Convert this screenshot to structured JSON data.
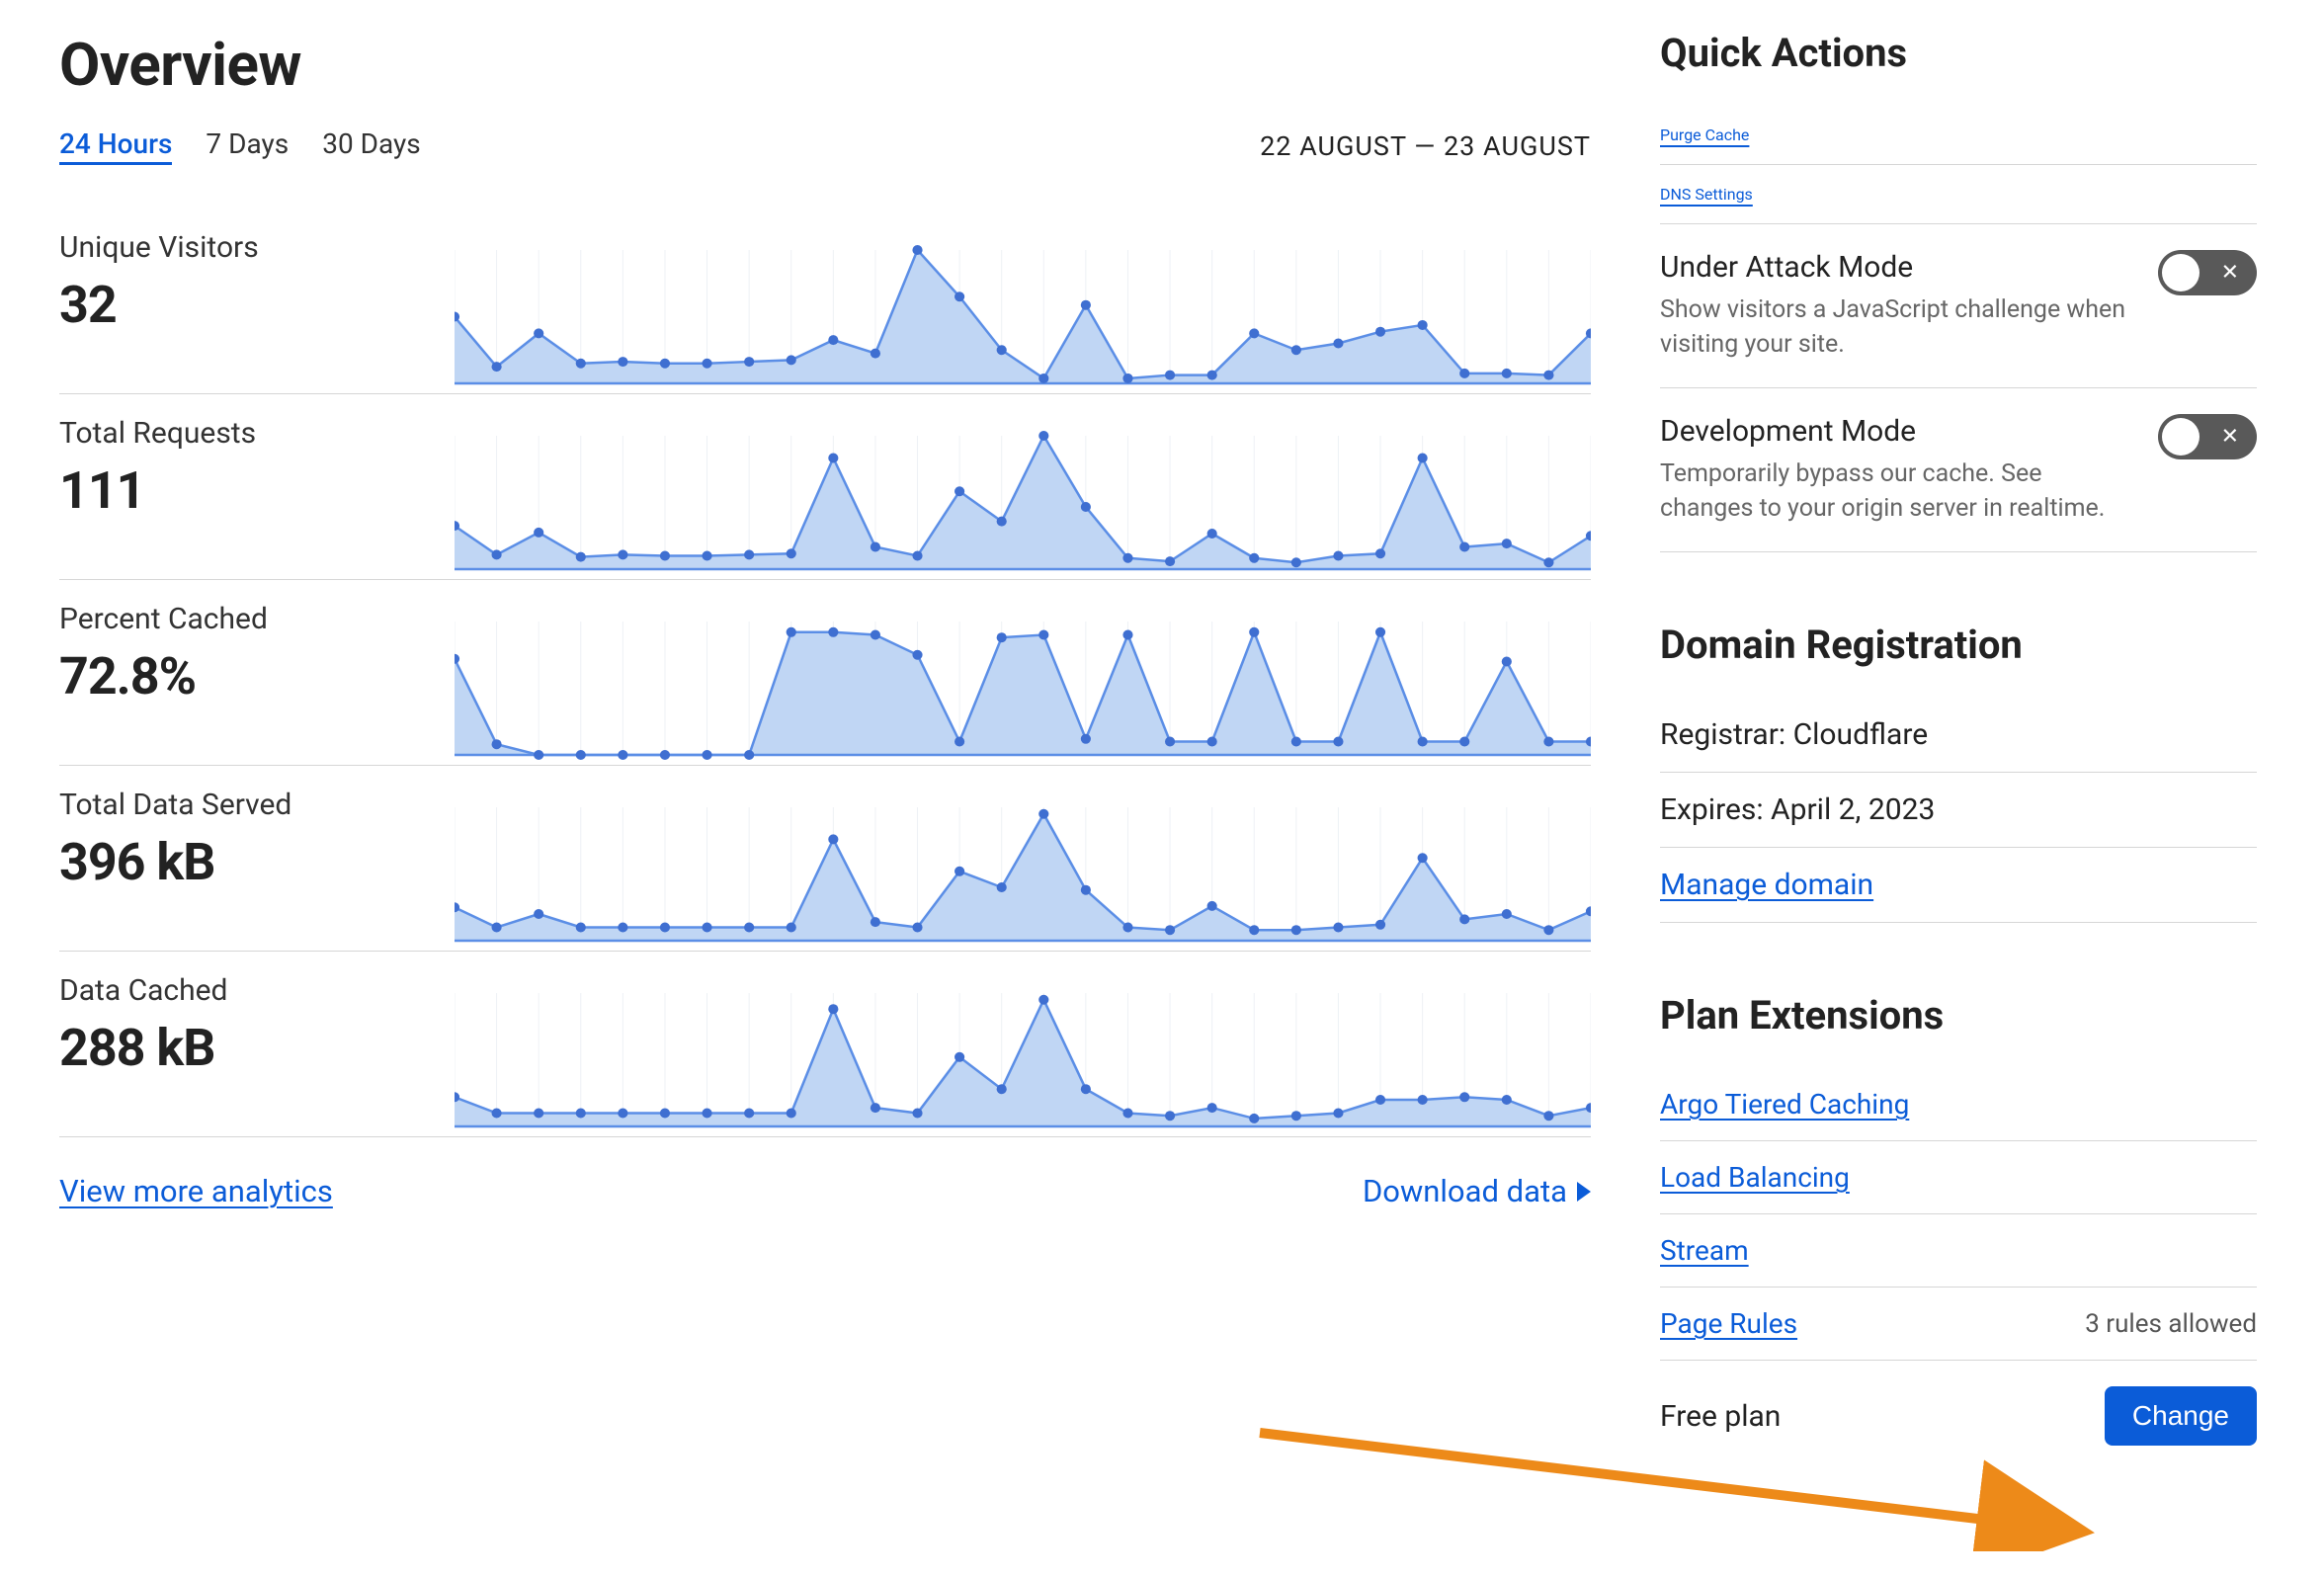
{
  "overview": {
    "title": "Overview",
    "tabs": [
      "24 Hours",
      "7 Days",
      "30 Days"
    ],
    "active_tab": 0,
    "date_range": "22 AUGUST — 23 AUGUST",
    "metrics": [
      {
        "label": "Unique Visitors",
        "value": "32"
      },
      {
        "label": "Total Requests",
        "value": "111"
      },
      {
        "label": "Percent Cached",
        "value": "72.8%"
      },
      {
        "label": "Total Data Served",
        "value": "396 kB"
      },
      {
        "label": "Data Cached",
        "value": "288 kB"
      }
    ],
    "view_more": "View more analytics",
    "download": "Download data"
  },
  "quick_actions": {
    "title": "Quick Actions",
    "links": [
      "Purge Cache",
      "DNS Settings"
    ],
    "toggles": [
      {
        "title": "Under Attack Mode",
        "sub": "Show visitors a JavaScript challenge when visiting your site.",
        "on": false
      },
      {
        "title": "Development Mode",
        "sub": "Temporarily bypass our cache. See changes to your origin server in realtime.",
        "on": false
      }
    ]
  },
  "domain_registration": {
    "title": "Domain Registration",
    "registrar_label": "Registrar: Cloudflare",
    "expires_label": "Expires: April 2, 2023",
    "manage_link": "Manage domain"
  },
  "plan_extensions": {
    "title": "Plan Extensions",
    "items": [
      {
        "label": "Argo Tiered Caching"
      },
      {
        "label": "Load Balancing"
      },
      {
        "label": "Stream"
      },
      {
        "label": "Page Rules",
        "hint": "3 rules allowed"
      }
    ],
    "plan_name": "Free plan",
    "change_button": "Change"
  },
  "colors": {
    "accent": "#0b5cd8",
    "chart_fill": "#c0d6f4",
    "chart_stroke": "#5b8ee6",
    "chart_dot": "#3f6fd1",
    "toggle_off": "#595959",
    "annotation": "#ed8a19"
  },
  "chart_data": [
    {
      "type": "area",
      "title": "Unique Visitors",
      "ylim": [
        0,
        8
      ],
      "values": [
        4,
        1,
        3,
        1.2,
        1.3,
        1.2,
        1.2,
        1.3,
        1.4,
        2.6,
        1.8,
        8,
        5.2,
        2,
        0.3,
        4.7,
        0.3,
        0.5,
        0.5,
        3,
        2,
        2.4,
        3.1,
        3.5,
        0.6,
        0.6,
        0.5,
        3
      ]
    },
    {
      "type": "area",
      "title": "Total Requests",
      "ylim": [
        0,
        12
      ],
      "values": [
        3.9,
        1.3,
        3.3,
        1.1,
        1.3,
        1.2,
        1.2,
        1.3,
        1.4,
        10,
        2,
        1.2,
        7,
        4.3,
        12,
        5.6,
        1,
        0.7,
        3.2,
        1,
        0.6,
        1.2,
        1.4,
        10,
        2,
        2.3,
        0.6,
        3
      ]
    },
    {
      "type": "area",
      "title": "Percent Cached",
      "ylim": [
        0,
        100
      ],
      "values": [
        72,
        8,
        0,
        0,
        0,
        0,
        0,
        0,
        92,
        92,
        90,
        75,
        10,
        88,
        90,
        12,
        90,
        10,
        10,
        92,
        10,
        10,
        92,
        10,
        10,
        70,
        10,
        10
      ]
    },
    {
      "type": "area",
      "title": "Total Data Served",
      "ylim": [
        0,
        100
      ],
      "values": [
        25,
        10,
        20,
        10,
        10,
        10,
        10,
        10,
        10,
        76,
        14,
        10,
        52,
        40,
        95,
        38,
        10,
        8,
        26,
        8,
        8,
        10,
        12,
        62,
        16,
        20,
        8,
        22
      ]
    },
    {
      "type": "area",
      "title": "Data Cached",
      "ylim": [
        0,
        100
      ],
      "values": [
        22,
        10,
        10,
        10,
        10,
        10,
        10,
        10,
        10,
        88,
        14,
        10,
        52,
        28,
        95,
        28,
        10,
        8,
        14,
        6,
        8,
        10,
        20,
        20,
        22,
        20,
        8,
        14
      ]
    }
  ]
}
